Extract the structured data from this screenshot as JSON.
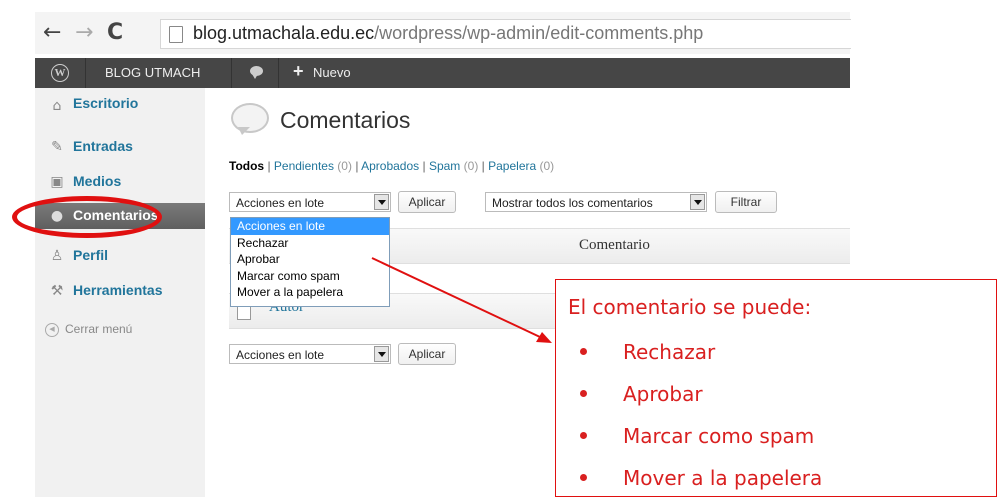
{
  "browser": {
    "back_icon": "back-arrow-icon",
    "forward_icon": "forward-arrow-icon",
    "reload_icon": "reload-icon",
    "url_host": "blog.utmachala.edu.ec",
    "url_path": "/wordpress/wp-admin/edit-comments.php"
  },
  "adminbar": {
    "site_name": "BLOG UTMACH",
    "new_label": "Nuevo"
  },
  "sidebar": {
    "items": [
      {
        "label": "Escritorio",
        "icon": "home-icon"
      },
      {
        "label": "Entradas",
        "icon": "pin-icon"
      },
      {
        "label": "Medios",
        "icon": "media-icon"
      },
      {
        "label": "Comentarios",
        "icon": "comment-icon",
        "active": true
      },
      {
        "label": "Perfil",
        "icon": "users-icon"
      },
      {
        "label": "Herramientas",
        "icon": "tools-icon"
      }
    ],
    "collapse_label": "Cerrar menú"
  },
  "main": {
    "title": "Comentarios",
    "filters": [
      {
        "label": "Todos",
        "count": ""
      },
      {
        "label": "Pendientes",
        "count": "(0)"
      },
      {
        "label": "Aprobados",
        "count": ""
      },
      {
        "label": "Spam",
        "count": "(0)"
      },
      {
        "label": "Papelera",
        "count": "(0)"
      }
    ],
    "bulk_select_value": "Acciones en lote",
    "apply_label": "Aplicar",
    "comment_type_select_value": "Mostrar todos los comentarios",
    "filter_label": "Filtrar",
    "bulk_options": [
      "Acciones en lote",
      "Rechazar",
      "Aprobar",
      "Marcar como spam",
      "Mover a la papelera"
    ],
    "column_comment": "Comentario",
    "column_author": "Autor",
    "bottom_bulk_select_value": "Acciones en lote",
    "bottom_apply_label": "Aplicar"
  },
  "callout": {
    "title": "El comentario se puede:",
    "items": [
      "Rechazar",
      "Aprobar",
      "Marcar como spam",
      "Mover a la papelera"
    ],
    "color": "#d92020"
  },
  "colors": {
    "link": "#21759b",
    "adminbar": "#464646",
    "highlight": "#e01010"
  }
}
